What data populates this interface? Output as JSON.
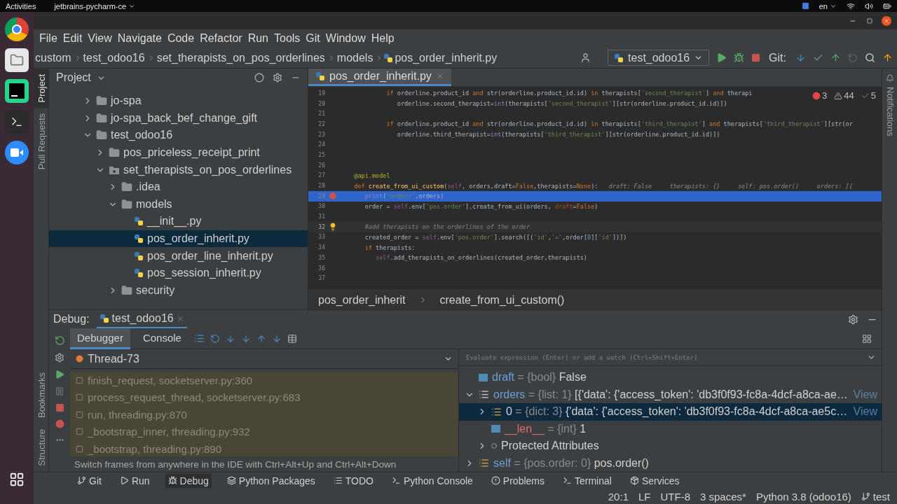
{
  "system_bar": {
    "activities": "Activities",
    "app_menu": "jetbrains-pycharm-ce",
    "language": "en"
  },
  "menu": [
    "File",
    "Edit",
    "View",
    "Navigate",
    "Code",
    "Refactor",
    "Run",
    "Tools",
    "Git",
    "Window",
    "Help"
  ],
  "breadcrumbs": [
    "custom",
    "test_odoo16",
    "set_therapists_on_pos_orderlines",
    "models",
    "pos_order_inherit.py"
  ],
  "run_config": "test_odoo16",
  "git_label": "Git:",
  "left_strip_top": [
    {
      "label": "Project",
      "selected": true
    },
    {
      "label": "Pull Requests",
      "selected": false
    }
  ],
  "left_strip_bottom": [
    {
      "label": "Bookmarks",
      "selected": false
    },
    {
      "label": "Structure",
      "selected": false
    }
  ],
  "right_strip": [
    "Notifications"
  ],
  "project": {
    "title": "Project",
    "tree": [
      {
        "label": "jo-spa",
        "kind": "folder",
        "expanded": false,
        "selected": false
      },
      {
        "label": "jo-spa_back_bef_change_gift",
        "kind": "folder",
        "expanded": false,
        "selected": false
      },
      {
        "label": "test_odoo16",
        "kind": "folder",
        "expanded": true,
        "selected": false,
        "children": [
          {
            "label": "pos_priceless_receipt_print",
            "kind": "folder",
            "expanded": false,
            "selected": false
          },
          {
            "label": "set_therapists_on_pos_orderlines",
            "kind": "package",
            "expanded": true,
            "selected": false,
            "children": [
              {
                "label": ".idea",
                "kind": "folder",
                "expanded": false,
                "selected": false
              },
              {
                "label": "models",
                "kind": "folder",
                "expanded": true,
                "selected": false,
                "children": [
                  {
                    "label": "__init__.py",
                    "kind": "python",
                    "selected": false
                  },
                  {
                    "label": "pos_order_inherit.py",
                    "kind": "python",
                    "selected": true
                  },
                  {
                    "label": "pos_order_line_inherit.py",
                    "kind": "python",
                    "selected": false
                  },
                  {
                    "label": "pos_session_inherit.py",
                    "kind": "python",
                    "selected": false
                  }
                ]
              },
              {
                "label": "security",
                "kind": "folder",
                "expanded": false,
                "selected": false
              }
            ]
          }
        ]
      }
    ]
  },
  "editor": {
    "tabs": [
      {
        "label": "pos_order_inherit.py",
        "selected": true
      }
    ],
    "inspections": {
      "errors": "3",
      "warnings": "44",
      "weak": "5"
    },
    "lines": [
      {
        "number": "19",
        "current": false,
        "breakpoint": false,
        "bulb": false,
        "tokens": [
          {
            "kind": "kw",
            "text": "            if"
          },
          {
            "kind": "plain",
            "text": " orderline.product_id "
          },
          {
            "kind": "kw",
            "text": "and"
          },
          {
            "kind": "plain",
            "text": " str(orderline.product_id.id) "
          },
          {
            "kind": "kw",
            "text": "in"
          },
          {
            "kind": "plain",
            "text": " therapists["
          },
          {
            "kind": "str",
            "text": "'second_therapist'"
          },
          {
            "kind": "plain",
            "text": "] "
          },
          {
            "kind": "kw",
            "text": "and"
          },
          {
            "kind": "plain",
            "text": " therapi"
          }
        ]
      },
      {
        "number": "20",
        "current": false,
        "breakpoint": false,
        "bulb": false,
        "tokens": [
          {
            "kind": "plain",
            "text": "               orderline.second_therapist="
          },
          {
            "kind": "builtin",
            "text": "int"
          },
          {
            "kind": "plain",
            "text": "(therapists["
          },
          {
            "kind": "str",
            "text": "'second_therapist'"
          },
          {
            "kind": "plain",
            "text": "][str(orderline.product_id.id)])"
          }
        ]
      },
      {
        "number": "21",
        "current": false,
        "breakpoint": false,
        "bulb": false
      },
      {
        "number": "22",
        "current": false,
        "breakpoint": false,
        "bulb": false,
        "tokens": [
          {
            "kind": "kw",
            "text": "            if"
          },
          {
            "kind": "plain",
            "text": " orderline.product_id "
          },
          {
            "kind": "kw",
            "text": "and"
          },
          {
            "kind": "plain",
            "text": " str(orderline.product_id.id) "
          },
          {
            "kind": "kw",
            "text": "in"
          },
          {
            "kind": "plain",
            "text": " therapists["
          },
          {
            "kind": "str",
            "text": "'third_therapist'"
          },
          {
            "kind": "plain",
            "text": "] "
          },
          {
            "kind": "kw",
            "text": "and"
          },
          {
            "kind": "plain",
            "text": " therapists["
          },
          {
            "kind": "str",
            "text": "'third_therapist'"
          },
          {
            "kind": "plain",
            "text": "][str(or"
          }
        ]
      },
      {
        "number": "23",
        "current": false,
        "breakpoint": false,
        "bulb": false,
        "tokens": [
          {
            "kind": "plain",
            "text": "               orderline.third_therapist="
          },
          {
            "kind": "builtin",
            "text": "int"
          },
          {
            "kind": "plain",
            "text": "(therapists["
          },
          {
            "kind": "str",
            "text": "'third_therapist'"
          },
          {
            "kind": "plain",
            "text": "][str(orderline.product_id.id)])"
          }
        ]
      },
      {
        "number": "24",
        "current": false,
        "breakpoint": false,
        "bulb": false
      },
      {
        "number": "25",
        "current": false,
        "breakpoint": false,
        "bulb": false
      },
      {
        "number": "26",
        "current": false,
        "breakpoint": false,
        "bulb": false
      },
      {
        "number": "27",
        "current": false,
        "breakpoint": false,
        "bulb": false,
        "tokens": [
          {
            "kind": "deco",
            "text": "   @api.model"
          }
        ]
      },
      {
        "number": "28",
        "current": false,
        "breakpoint": false,
        "bulb": false,
        "tokens": [
          {
            "kind": "kw",
            "text": "   def "
          },
          {
            "kind": "fn",
            "text": "create_from_ui_custom"
          },
          {
            "kind": "plain",
            "text": "("
          },
          {
            "kind": "self",
            "text": "self"
          },
          {
            "kind": "plain",
            "text": ", orders,draft="
          },
          {
            "kind": "kw",
            "text": "False"
          },
          {
            "kind": "plain",
            "text": ",therapists="
          },
          {
            "kind": "kw",
            "text": "None"
          },
          {
            "kind": "plain",
            "text": "):"
          },
          {
            "kind": "hint",
            "text": "   draft: False     therapists: {}     self: pos.order()     orders: [{"
          }
        ]
      },
      {
        "number": "29",
        "current": true,
        "breakpoint": true,
        "bulb": false,
        "tokens": [
          {
            "kind": "builtin",
            "text": "      print"
          },
          {
            "kind": "plain",
            "text": "("
          },
          {
            "kind": "str",
            "text": "'orders'"
          },
          {
            "kind": "plain",
            "text": ",orders)"
          }
        ]
      },
      {
        "number": "30",
        "current": false,
        "breakpoint": false,
        "bulb": false,
        "tokens": [
          {
            "kind": "plain",
            "text": "      order = "
          },
          {
            "kind": "self",
            "text": "self"
          },
          {
            "kind": "plain",
            "text": ".env["
          },
          {
            "kind": "str",
            "text": "'pos.order'"
          },
          {
            "kind": "plain",
            "text": "].create_from_ui(orders, "
          },
          {
            "kind": "param",
            "text": "draft"
          },
          {
            "kind": "plain",
            "text": "="
          },
          {
            "kind": "kw",
            "text": "False"
          },
          {
            "kind": "plain",
            "text": ")"
          }
        ]
      },
      {
        "number": "31",
        "current": false,
        "breakpoint": false,
        "bulb": false
      },
      {
        "number": "32",
        "current": false,
        "breakpoint": false,
        "bulb": true,
        "tokens": [
          {
            "kind": "comment",
            "text": "      #add therapists on the orderlines of the order"
          }
        ]
      },
      {
        "number": "33",
        "current": false,
        "breakpoint": false,
        "bulb": false,
        "tokens": [
          {
            "kind": "plain",
            "text": "      created_order = "
          },
          {
            "kind": "self",
            "text": "self"
          },
          {
            "kind": "plain",
            "text": ".env["
          },
          {
            "kind": "str",
            "text": "'pos.order'"
          },
          {
            "kind": "plain",
            "text": "].search([("
          },
          {
            "kind": "str",
            "text": "'id'"
          },
          {
            "kind": "plain",
            "text": ","
          },
          {
            "kind": "str",
            "text": "'='"
          },
          {
            "kind": "plain",
            "text": ",order["
          },
          {
            "kind": "num",
            "text": "0"
          },
          {
            "kind": "plain",
            "text": "]["
          },
          {
            "kind": "str",
            "text": "'id'"
          },
          {
            "kind": "plain",
            "text": "])])"
          }
        ]
      },
      {
        "number": "34",
        "current": false,
        "breakpoint": false,
        "bulb": false,
        "tokens": [
          {
            "kind": "kw",
            "text": "      if"
          },
          {
            "kind": "plain",
            "text": " therapists:"
          }
        ]
      },
      {
        "number": "35",
        "current": false,
        "breakpoint": false,
        "bulb": false,
        "tokens": [
          {
            "kind": "self",
            "text": "         self"
          },
          {
            "kind": "plain",
            "text": ".add_therapists_on_orderlines(created_order,therapists)"
          }
        ]
      },
      {
        "number": "36",
        "current": false,
        "breakpoint": false,
        "bulb": false
      },
      {
        "number": "37",
        "current": false,
        "breakpoint": false,
        "bulb": false
      }
    ],
    "breadcrumbs": [
      "pos_order_inherit",
      "create_from_ui_custom()"
    ]
  },
  "debug": {
    "title": "Debug:",
    "sessions": [
      {
        "label": "test_odoo16",
        "selected": true
      }
    ],
    "tabs": [
      {
        "label": "Debugger",
        "selected": true
      },
      {
        "label": "Console",
        "selected": false
      }
    ],
    "thread": "Thread-73",
    "frames": [
      {
        "text": "finish_request, socketserver.py:360",
        "library": true
      },
      {
        "text": "process_request_thread, socketserver.py:683",
        "library": true
      },
      {
        "text": "run, threading.py:870",
        "library": true
      },
      {
        "text": "_bootstrap_inner, threading.py:932",
        "library": true
      },
      {
        "text": "_bootstrap, threading.py:890",
        "library": true
      }
    ],
    "tip": "Switch frames from anywhere in the IDE with Ctrl+Alt+Up and Ctrl+Alt+Down",
    "watch_placeholder": "Evaluate expression (Enter) or add a watch (Ctrl+Shift+Enter)",
    "variables": [
      {
        "kind": "scalar",
        "name": "draft",
        "equals": "=",
        "type": "{bool}",
        "value": "False",
        "selected": false
      },
      {
        "kind": "list",
        "name": "orders",
        "equals": "=",
        "type": "{list: 1}",
        "value": "[{'data': {'access_token': 'db3f0f93-fc8a-4dcf-a8ca-ae…",
        "link": "View",
        "expanded": true,
        "selected": false,
        "children": [
          {
            "kind": "dict",
            "name": "0",
            "equals": "=",
            "type": "{dict: 3}",
            "value": "{'data': {'access_token': 'db3f0f93-fc8a-4dcf-a8ca-ae5c…",
            "link": "View",
            "expanded": false,
            "selected": true
          },
          {
            "kind": "special",
            "name": "__len__",
            "equals": "=",
            "type": "{int}",
            "value": "1",
            "selected": false
          },
          {
            "kind": "group",
            "name": "Protected Attributes",
            "expanded": false,
            "selected": false
          }
        ]
      },
      {
        "kind": "object",
        "name": "self",
        "equals": "=",
        "type": "{pos.order: 0}",
        "value": "pos.order()",
        "expanded": false,
        "selected": false
      }
    ]
  },
  "tool_windows": [
    {
      "label": "Git",
      "selected": false
    },
    {
      "label": "Run",
      "selected": false
    },
    {
      "label": "Debug",
      "selected": true
    },
    {
      "label": "Python Packages",
      "selected": false
    },
    {
      "label": "TODO",
      "selected": false
    },
    {
      "label": "Python Console",
      "selected": false
    },
    {
      "label": "Problems",
      "selected": false
    },
    {
      "label": "Terminal",
      "selected": false
    },
    {
      "label": "Services",
      "selected": false
    }
  ],
  "status_bar": [
    "20:1",
    "LF",
    "UTF-8",
    "3 spaces*",
    "Python 3.8 (odoo16)",
    "test"
  ]
}
